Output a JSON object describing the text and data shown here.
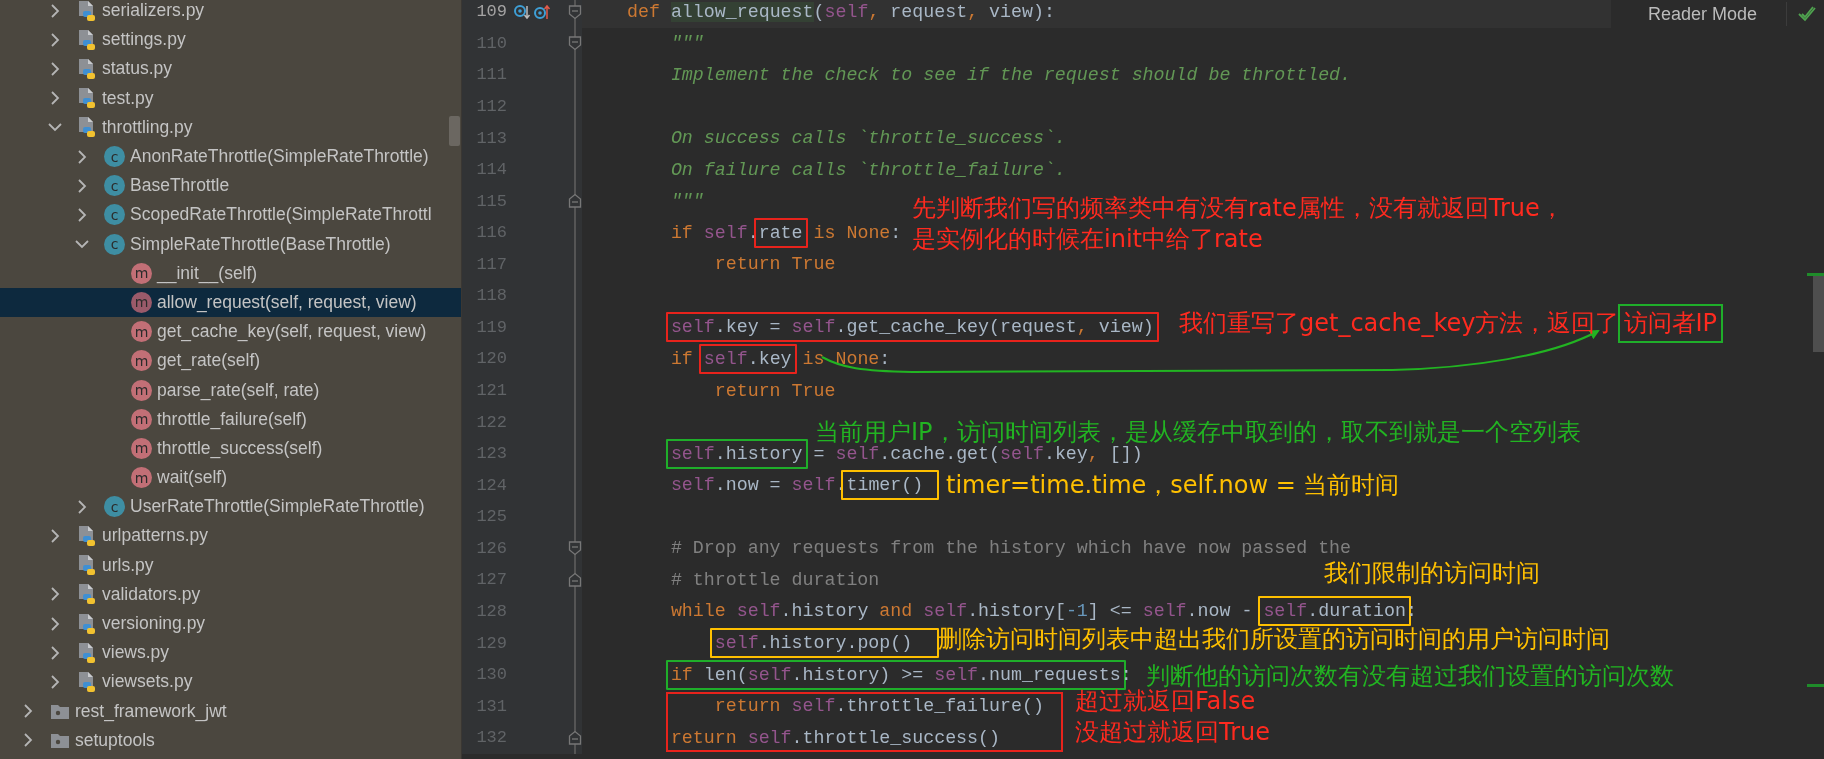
{
  "tree": {
    "nested_items": [
      {
        "label": "serializers.py",
        "kind": "file",
        "expanded": false,
        "selected": false
      },
      {
        "label": "settings.py",
        "kind": "file",
        "expanded": false,
        "selected": false
      },
      {
        "label": "status.py",
        "kind": "file",
        "expanded": false,
        "selected": false
      },
      {
        "label": "test.py",
        "kind": "file",
        "expanded": false,
        "selected": false
      },
      {
        "label": "throttling.py",
        "kind": "file",
        "expanded": true,
        "selected": false,
        "children": [
          {
            "label": "AnonRateThrottle(SimpleRateThrottle)",
            "kind": "class",
            "badge": "c",
            "expanded": false,
            "selected": false
          },
          {
            "label": "BaseThrottle",
            "kind": "class",
            "badge": "c",
            "expanded": false,
            "selected": false
          },
          {
            "label": "ScopedRateThrottle(SimpleRateThrottl",
            "kind": "class",
            "badge": "c",
            "expanded": false,
            "selected": false
          },
          {
            "label": "SimpleRateThrottle(BaseThrottle)",
            "kind": "class",
            "badge": "c",
            "expanded": true,
            "selected": false,
            "children": [
              {
                "label": "__init__(self)",
                "kind": "method",
                "badge": "m",
                "selected": false
              },
              {
                "label": "allow_request(self, request, view)",
                "kind": "method",
                "badge": "m",
                "selected": true
              },
              {
                "label": "get_cache_key(self, request, view)",
                "kind": "method",
                "badge": "m",
                "selected": false
              },
              {
                "label": "get_rate(self)",
                "kind": "method",
                "badge": "m",
                "selected": false
              },
              {
                "label": "parse_rate(self, rate)",
                "kind": "method",
                "badge": "m",
                "selected": false
              },
              {
                "label": "throttle_failure(self)",
                "kind": "method",
                "badge": "m",
                "selected": false
              },
              {
                "label": "throttle_success(self)",
                "kind": "method",
                "badge": "m",
                "selected": false
              },
              {
                "label": "wait(self)",
                "kind": "method",
                "badge": "m",
                "selected": false
              }
            ]
          },
          {
            "label": "UserRateThrottle(SimpleRateThrottle)",
            "kind": "class",
            "badge": "c",
            "expanded": false,
            "selected": false
          }
        ]
      },
      {
        "label": "urlpatterns.py",
        "kind": "file",
        "expanded": false,
        "selected": false
      },
      {
        "label": "urls.py",
        "kind": "file",
        "selected": false
      },
      {
        "label": "validators.py",
        "kind": "file",
        "expanded": false,
        "selected": false
      },
      {
        "label": "versioning.py",
        "kind": "file",
        "expanded": false,
        "selected": false
      },
      {
        "label": "views.py",
        "kind": "file",
        "expanded": false,
        "selected": false
      },
      {
        "label": "viewsets.py",
        "kind": "file",
        "expanded": false,
        "selected": false
      }
    ],
    "items": [
      {
        "label": "rest_framework_jwt",
        "kind": "folder",
        "expanded": false,
        "selected": false
      },
      {
        "label": "setuptools",
        "kind": "folder",
        "expanded": false,
        "selected": false
      }
    ]
  },
  "editor": {
    "reader_mode": "Reader Mode",
    "lines": [
      {
        "number": "109",
        "current": true,
        "fold_open": true,
        "overrides": true,
        "segments": [
          {
            "tokens": [
              {
                "kind": "keyword",
                "text": "def "
              },
              {
                "kind": "function",
                "text": "allow_request"
              },
              {
                "kind": "name",
                "text": "("
              },
              {
                "kind": "self",
                "text": "self"
              },
              {
                "kind": "keyword",
                "text": ", "
              },
              {
                "kind": "name",
                "text": "request"
              },
              {
                "kind": "keyword",
                "text": ", "
              },
              {
                "kind": "name",
                "text": "view):"
              }
            ]
          }
        ],
        "children": [
          {
            "number": "110",
            "fold_open": true,
            "segments": [
              {
                "tokens": [
                  {
                    "kind": "docstring",
                    "text": "\"\"\""
                  }
                ]
              }
            ]
          },
          {
            "number": "111",
            "segments": [
              {
                "tokens": [
                  {
                    "kind": "docstring",
                    "text": "Implement the check to see if the request should be throttled."
                  }
                ]
              }
            ]
          },
          {
            "number": "112"
          },
          {
            "number": "113",
            "segments": [
              {
                "tokens": [
                  {
                    "kind": "docstring",
                    "text": "On success calls `throttle_success`."
                  }
                ]
              }
            ]
          },
          {
            "number": "114",
            "segments": [
              {
                "tokens": [
                  {
                    "kind": "docstring",
                    "text": "On failure calls `throttle_failure`."
                  }
                ]
              }
            ]
          },
          {
            "number": "115",
            "fold_close": true,
            "segments": [
              {
                "tokens": [
                  {
                    "kind": "docstring",
                    "text": "\"\"\""
                  }
                ]
              }
            ]
          },
          {
            "number": "116",
            "segments": [
              {
                "tokens": [
                  {
                    "kind": "keyword",
                    "text": "if "
                  },
                  {
                    "kind": "self",
                    "text": "self"
                  },
                  {
                    "kind": "name",
                    "text": "."
                  }
                ]
              },
              {
                "color": "#e8231c",
                "tokens": [
                  {
                    "kind": "name",
                    "text": "rate"
                  }
                ]
              },
              {
                "tokens": [
                  {
                    "kind": "keyword",
                    "text": " is None"
                  },
                  {
                    "kind": "name",
                    "text": ":"
                  }
                ]
              }
            ],
            "children": [
              {
                "number": "117",
                "segments": [
                  {
                    "tokens": [
                      {
                        "kind": "keyword",
                        "text": "return True"
                      }
                    ]
                  }
                ]
              }
            ]
          },
          {
            "number": "118"
          },
          {
            "number": "119",
            "segments": [
              {
                "color": "#e8231c",
                "tokens": [
                  {
                    "kind": "self",
                    "text": "self"
                  },
                  {
                    "kind": "name",
                    "text": ".key = "
                  },
                  {
                    "kind": "self",
                    "text": "self"
                  },
                  {
                    "kind": "name",
                    "text": ".get_cache_key(request"
                  },
                  {
                    "kind": "keyword",
                    "text": ", "
                  },
                  {
                    "kind": "name",
                    "text": "view)"
                  }
                ]
              }
            ]
          },
          {
            "number": "120",
            "segments": [
              {
                "tokens": [
                  {
                    "kind": "keyword",
                    "text": "if "
                  }
                ]
              },
              {
                "color": "#e8231c",
                "tokens": [
                  {
                    "kind": "self",
                    "text": "self"
                  },
                  {
                    "kind": "name",
                    "text": ".key"
                  }
                ]
              },
              {
                "tokens": [
                  {
                    "kind": "keyword",
                    "text": " is None"
                  },
                  {
                    "kind": "name",
                    "text": ":"
                  }
                ]
              }
            ],
            "children": [
              {
                "number": "121",
                "segments": [
                  {
                    "tokens": [
                      {
                        "kind": "keyword",
                        "text": "return True"
                      }
                    ]
                  }
                ]
              }
            ]
          },
          {
            "number": "122"
          },
          {
            "number": "123",
            "segments": [
              {
                "color": "#1fae2a",
                "tokens": [
                  {
                    "kind": "self",
                    "text": "self"
                  },
                  {
                    "kind": "name",
                    "text": ".history"
                  }
                ]
              },
              {
                "tokens": [
                  {
                    "kind": "name",
                    "text": " = "
                  },
                  {
                    "kind": "self",
                    "text": "self"
                  },
                  {
                    "kind": "name",
                    "text": ".cache.get("
                  },
                  {
                    "kind": "self",
                    "text": "self"
                  },
                  {
                    "kind": "name",
                    "text": ".key"
                  },
                  {
                    "kind": "keyword",
                    "text": ", "
                  },
                  {
                    "kind": "name",
                    "text": "[])"
                  }
                ]
              }
            ]
          },
          {
            "number": "124",
            "segments": [
              {
                "tokens": [
                  {
                    "kind": "self",
                    "text": "self"
                  },
                  {
                    "kind": "name",
                    "text": ".now = "
                  },
                  {
                    "kind": "self",
                    "text": "self"
                  },
                  {
                    "kind": "name",
                    "text": "."
                  }
                ]
              },
              {
                "color": "#ffc000",
                "tokens": [
                  {
                    "kind": "name",
                    "text": "timer() "
                  }
                ]
              }
            ]
          },
          {
            "number": "125"
          },
          {
            "number": "126",
            "fold_open": true,
            "segments": [
              {
                "tokens": [
                  {
                    "kind": "comment",
                    "text": "# Drop any requests from the history which have now passed the"
                  }
                ]
              }
            ]
          },
          {
            "number": "127",
            "fold_close": true,
            "segments": [
              {
                "tokens": [
                  {
                    "kind": "comment",
                    "text": "# throttle duration"
                  }
                ]
              }
            ]
          },
          {
            "number": "128",
            "segments": [
              {
                "tokens": [
                  {
                    "kind": "keyword",
                    "text": "while "
                  },
                  {
                    "kind": "self",
                    "text": "self"
                  },
                  {
                    "kind": "name",
                    "text": ".history "
                  },
                  {
                    "kind": "keyword",
                    "text": "and "
                  },
                  {
                    "kind": "self",
                    "text": "self"
                  },
                  {
                    "kind": "name",
                    "text": ".history["
                  },
                  {
                    "kind": "number",
                    "text": "-1"
                  },
                  {
                    "kind": "name",
                    "text": "] <= "
                  },
                  {
                    "kind": "self",
                    "text": "self"
                  },
                  {
                    "kind": "name",
                    "text": ".now - "
                  }
                ]
              },
              {
                "color": "#ffc000",
                "tokens": [
                  {
                    "kind": "self",
                    "text": "self"
                  },
                  {
                    "kind": "name",
                    "text": ".duration"
                  }
                ]
              },
              {
                "tokens": [
                  {
                    "kind": "name",
                    "text": ":"
                  }
                ]
              }
            ],
            "children": [
              {
                "number": "129",
                "segments": [
                  {
                    "color": "#ffc000",
                    "tokens": [
                      {
                        "kind": "self",
                        "text": "self"
                      },
                      {
                        "kind": "name",
                        "text": ".history.pop()  "
                      }
                    ]
                  }
                ]
              }
            ]
          },
          {
            "number": "130",
            "segments": [
              {
                "color": "#1fae2a",
                "tokens": [
                  {
                    "kind": "keyword",
                    "text": "if "
                  },
                  {
                    "kind": "name",
                    "text": "len("
                  },
                  {
                    "kind": "self",
                    "text": "self"
                  },
                  {
                    "kind": "name",
                    "text": ".history) >= "
                  },
                  {
                    "kind": "self",
                    "text": "self"
                  },
                  {
                    "kind": "name",
                    "text": ".num_requests"
                  }
                ]
              },
              {
                "tokens": [
                  {
                    "kind": "name",
                    "text": ":"
                  }
                ]
              }
            ],
            "children": [
              {
                "number": "131",
                "frame": {
                  "color": "#e8231c"
                },
                "segments": [
                  {
                    "tokens": [
                      {
                        "kind": "keyword",
                        "text": "return "
                      },
                      {
                        "kind": "self",
                        "text": "self"
                      },
                      {
                        "kind": "name",
                        "text": ".throttle_failure()"
                      }
                    ]
                  }
                ]
              }
            ]
          },
          {
            "number": "132",
            "frame": {
              "color": "#e8231c"
            },
            "fold_close": true,
            "segments": [
              {
                "tokens": [
                  {
                    "kind": "keyword",
                    "text": "return "
                  },
                  {
                    "kind": "self",
                    "text": "self"
                  },
                  {
                    "kind": "name",
                    "text": ".throttle_success()"
                  }
                ]
              }
            ]
          }
        ]
      }
    ]
  },
  "annotations": [
    {
      "color": "#ff2a1f",
      "lines": [
        "先判断我们写的频率类中有没有rate属性，没有就返回True，",
        "是实例化的时候在init中给了rate"
      ]
    },
    {
      "color": "#ff2a1f",
      "lines": [
        "我们重写了get_cache_key方法，返回了"
      ],
      "boxed": {
        "text": "访问者IP",
        "color": "#1fae2a"
      }
    },
    {
      "color": "#22b422",
      "lines": [
        "当前用户IP，访问时间列表，是从缓存中取到的，取不到就是一个空列表"
      ]
    },
    {
      "color": "#ffc000",
      "lines": [
        "timer=time.time，self.now = 当前时间"
      ]
    },
    {
      "color": "#ffc000",
      "lines": [
        "我们限制的访问时间"
      ]
    },
    {
      "color": "#ffc000",
      "lines": [
        "删除访问时间列表中超出我们所设置的访问时间的用户访问时间"
      ]
    },
    {
      "color": "#22b422",
      "lines": [
        "判断他的访问次数有没有超过我们设置的访问次数"
      ]
    },
    {
      "color": "#ff2a1f",
      "lines": [
        "超过就返回False",
        "没超过就返回True"
      ]
    }
  ]
}
